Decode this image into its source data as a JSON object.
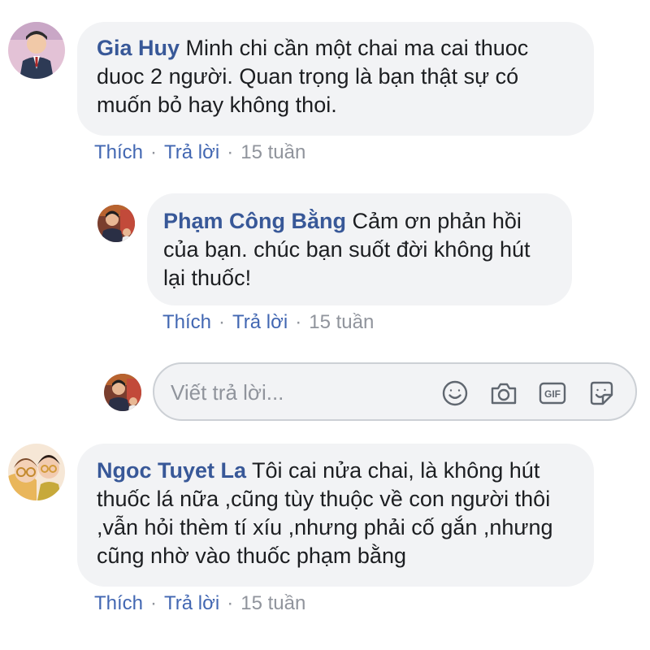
{
  "comments": [
    {
      "author": "Gia Huy",
      "text": "Minh chi cần một chai ma cai thuoc duoc 2 người. Quan trọng là bạn thật sự có muốn bỏ hay không thoi.",
      "like_label": "Thích",
      "reply_label": "Trả lời",
      "time": "15 tuần",
      "avatar": "child-in-suit-photo"
    },
    {
      "author": "Phạm Công Bằng",
      "text": "Cảm ơn phản hồi của bạn. chúc bạn suốt đời không hút lại thuốc!",
      "like_label": "Thích",
      "reply_label": "Trả lời",
      "time": "15 tuần",
      "avatar": "person-photo"
    },
    {
      "author": "Ngoc Tuyet La",
      "text": "Tôi cai nửa chai, là không hút thuốc lá nữa ,cũng tùy thuộc về con người thôi ,vẫn hỏi thèm tí xíu ,nhưng phải cố gắn ,nhưng cũng nhờ vào thuốc phạm bằng",
      "like_label": "Thích",
      "reply_label": "Trả lời",
      "time": "15 tuần",
      "avatar": "two-people-photo"
    }
  ],
  "reply_box": {
    "placeholder": "Viết trả lời...",
    "icons": [
      "emoji-icon",
      "camera-icon",
      "gif-icon",
      "sticker-icon"
    ],
    "gif_text": "GIF"
  },
  "colors": {
    "author": "#385898",
    "link": "#4267b2",
    "meta": "#90949c",
    "bubble": "#f2f3f5"
  }
}
